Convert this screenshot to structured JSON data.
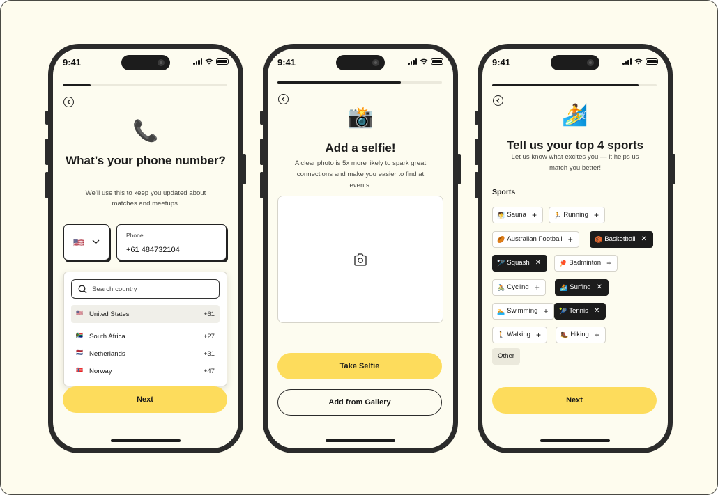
{
  "status": {
    "time": "9:41"
  },
  "phone1": {
    "progress": 0.17,
    "icon_glyph": "📞",
    "title": "What’s your phone number?",
    "subtitle": "We’ll use this to keep you updated about matches and meetups.",
    "selected_flag": "🇺🇸",
    "phone_label": "Phone",
    "phone_value": "+61 484732104",
    "search_placeholder": "Search country",
    "countries": [
      {
        "flag": "🇺🇸",
        "name": "United States",
        "code": "+61"
      },
      {
        "flag": "🇿🇦",
        "name": "South Africa",
        "code": "+27"
      },
      {
        "flag": "🇳🇱",
        "name": "Netherlands",
        "code": "+31"
      },
      {
        "flag": "🇳🇴",
        "name": "Norway",
        "code": "+47"
      }
    ],
    "next_label": "Next"
  },
  "phone2": {
    "progress": 0.75,
    "icon_glyph": "📸",
    "title": "Add a selfie!",
    "subtitle": "A clear photo is 5x more likely to spark great connections and make you easier to find at events.",
    "take_label": "Take Selfie",
    "gallery_label": "Add from Gallery"
  },
  "phone3": {
    "progress": 0.89,
    "icon_glyph": "🏄",
    "title": "Tell us your top 4 sports",
    "subtitle": "Let us know what excites you — it helps us match you better!",
    "sports_label": "Sports",
    "sports": [
      {
        "emoji": "🧖",
        "name": "Sauna",
        "selected": false
      },
      {
        "emoji": "🏃",
        "name": "Running",
        "selected": false
      },
      {
        "emoji": "🏉",
        "name": "Australian Football",
        "selected": false
      },
      {
        "emoji": "🏀",
        "name": "Basketball",
        "selected": true
      },
      {
        "emoji": "🏸",
        "name": "Squash",
        "selected": true
      },
      {
        "emoji": "🏓",
        "name": "Badminton",
        "selected": false
      },
      {
        "emoji": "🚴",
        "name": "Cycling",
        "selected": false
      },
      {
        "emoji": "🏄",
        "name": "Surfing",
        "selected": true
      },
      {
        "emoji": "🏊",
        "name": "Swimming",
        "selected": false
      },
      {
        "emoji": "🎾",
        "name": "Tennis",
        "selected": true
      },
      {
        "emoji": "🚶",
        "name": "Walking",
        "selected": false
      },
      {
        "emoji": "🥾",
        "name": "Hiking",
        "selected": false
      }
    ],
    "other_label": "Other",
    "next_label": "Next"
  },
  "icons": {
    "add": "+",
    "remove": "✕"
  }
}
